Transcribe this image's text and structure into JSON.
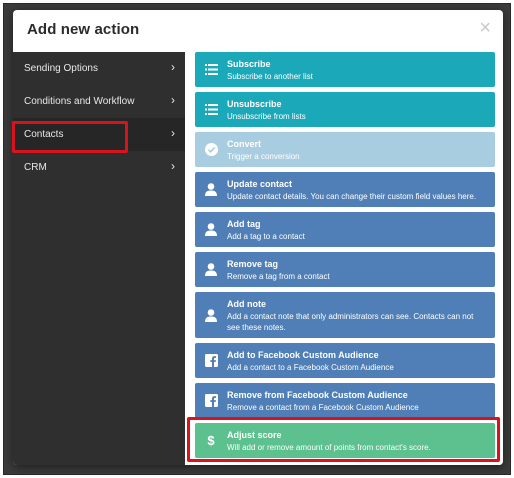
{
  "modal": {
    "title": "Add new action",
    "close_glyph": "×"
  },
  "sidebar": {
    "items": [
      {
        "label": "Sending Options",
        "chevron": "›"
      },
      {
        "label": "Conditions and Workflow",
        "chevron": "›"
      },
      {
        "label": "Contacts",
        "chevron": "›",
        "active": true,
        "highlighted": true
      },
      {
        "label": "CRM",
        "chevron": "›"
      }
    ]
  },
  "actions": [
    {
      "title": "Subscribe",
      "desc": "Subscribe to another list",
      "icon": "list-icon",
      "color": "#1ba8b9"
    },
    {
      "title": "Unsubscribe",
      "desc": "Unsubscribe from lists",
      "icon": "list-icon",
      "color": "#1ba8b9"
    },
    {
      "title": "Convert",
      "desc": "Trigger a conversion",
      "icon": "check-circle-icon",
      "color": "#a9cde0"
    },
    {
      "title": "Update contact",
      "desc": "Update contact details. You can change their custom field values here.",
      "icon": "user-icon",
      "color": "#4f7fb6"
    },
    {
      "title": "Add tag",
      "desc": "Add a tag to a contact",
      "icon": "user-icon",
      "color": "#4f7fb6"
    },
    {
      "title": "Remove tag",
      "desc": "Remove a tag from a contact",
      "icon": "user-icon",
      "color": "#4f7fb6"
    },
    {
      "title": "Add note",
      "desc": "Add a contact note that only administrators can see. Contacts can not see these notes.",
      "icon": "user-icon",
      "color": "#4f7fb6"
    },
    {
      "title": "Add to Facebook Custom Audience",
      "desc": "Add a contact to a Facebook Custom Audience",
      "icon": "facebook-icon",
      "color": "#4f7fb6"
    },
    {
      "title": "Remove from Facebook Custom Audience",
      "desc": "Remove a contact from a Facebook Custom Audience",
      "icon": "facebook-icon",
      "color": "#4f7fb6"
    },
    {
      "title": "Adjust score",
      "desc": "Will add or remove amount of points from contact's score.",
      "icon": "dollar-icon",
      "icon_glyph": "$",
      "color": "#5cc08f",
      "highlighted": true
    }
  ],
  "highlight_color": "#d6141d"
}
